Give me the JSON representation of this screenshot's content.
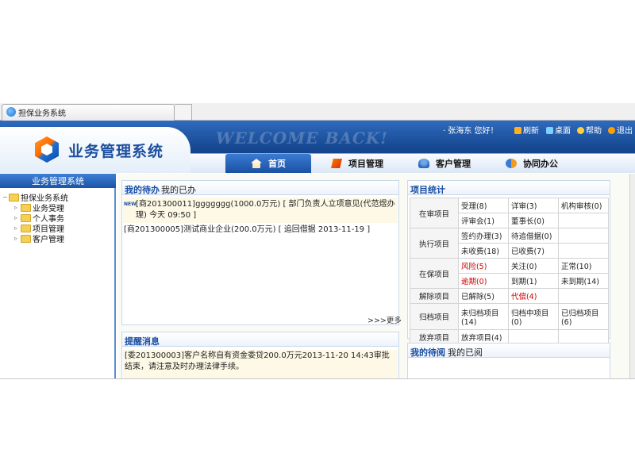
{
  "browser": {
    "tab_title": "担保业务系统"
  },
  "header": {
    "app_title": "业务管理系统",
    "welcome_text": "WELCOME BACK!",
    "user_greeting": "· 张海东 您好！",
    "links": [
      {
        "label": "刷新",
        "icon": "refresh-icon"
      },
      {
        "label": "桌面",
        "icon": "desktop-icon"
      },
      {
        "label": "帮助",
        "icon": "help-icon"
      },
      {
        "label": "退出",
        "icon": "exit-icon"
      }
    ]
  },
  "nav": {
    "tabs": [
      {
        "label": "首页",
        "icon": "home-icon",
        "active": true
      },
      {
        "label": "项目管理",
        "icon": "project-icon"
      },
      {
        "label": "客户管理",
        "icon": "customer-icon"
      },
      {
        "label": "协同办公",
        "icon": "collaboration-icon"
      }
    ]
  },
  "sidebar": {
    "title": "业务管理系统",
    "root": "担保业务系统",
    "items": [
      "业务受理",
      "个人事务",
      "项目管理",
      "客户管理"
    ]
  },
  "todo": {
    "tab_active": "我的待办",
    "tab_other": "我的已办",
    "item1": "[商201300011]ggggggg(1000.0万元) [ 部门负责人立项意见(代范煜办理)  今天 09:50 ]",
    "item2": "[商201300005]测试商业企业(200.0万元) [ 追回借据  2013-11-19 ]",
    "more": ">>>更多",
    "new_badge": "NEW"
  },
  "reminder": {
    "title": "提醒消息",
    "text": "[委201300003]客户名称自有资金委贷200.0万元2013-11-20 14:43审批结束，请注意及时办理法律手续。"
  },
  "stats": {
    "title": "项目统计",
    "rows": {
      "review_label": "在审项目",
      "review": [
        "受理(8)",
        "详审(3)",
        "机构审核(0)",
        "评审会(1)",
        "董事长(0)"
      ],
      "exec_label": "执行项目",
      "exec": [
        "签约办理(3)",
        "待追借据(0)",
        "未收费(18)",
        "已收费(7)"
      ],
      "guarantee_label": "在保项目",
      "guarantee": [
        "风险(5)",
        "关注(0)",
        "正常(10)",
        "逾期(0)",
        "到期(1)",
        "未到期(14)"
      ],
      "release_label": "解除项目",
      "release": [
        "已解除(5)",
        "代偿(4)"
      ],
      "archive_label": "归档项目",
      "archive": [
        "未归档项目(14)",
        "归档中项目(0)",
        "已归档项目(6)"
      ],
      "abandon_label": "放弃项目",
      "abandon": [
        "放弃项目(4)"
      ]
    }
  },
  "review": {
    "tab_active": "我的待阅",
    "tab_other": "我的已阅"
  },
  "colors": {
    "header_blue": "#15468f",
    "risk_red": "#d00000"
  }
}
